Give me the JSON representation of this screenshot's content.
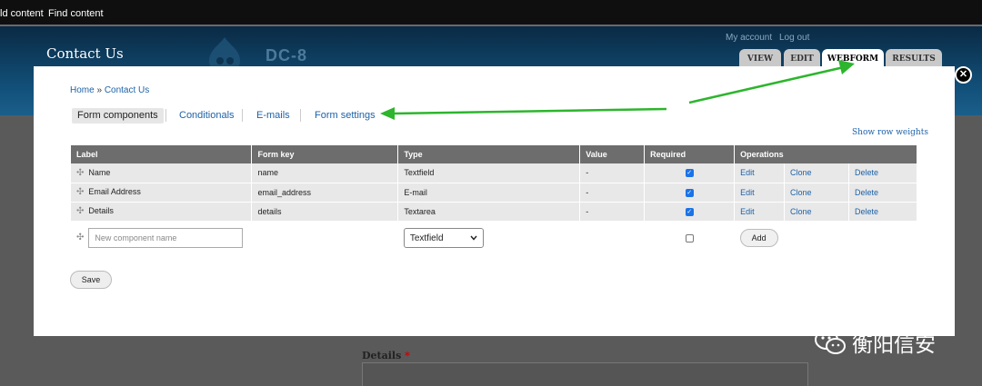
{
  "toolbar": {
    "link1": "ld content",
    "link2": "Find content"
  },
  "header": {
    "slogan": "Contact Us",
    "site_name": "DC-8",
    "secondary_menu": [
      "My account",
      "Log out"
    ],
    "tabs": [
      {
        "label": "VIEW",
        "active": false
      },
      {
        "label": "EDIT",
        "active": false
      },
      {
        "label": "WEBFORM",
        "active": true
      },
      {
        "label": "RESULTS",
        "active": false
      }
    ]
  },
  "overlay": {
    "breadcrumb": {
      "home": "Home",
      "sep": " » ",
      "current": "Contact Us"
    },
    "subtabs": [
      {
        "label": "Form components",
        "active": true
      },
      {
        "label": "Conditionals",
        "active": false
      },
      {
        "label": "E-mails",
        "active": false
      },
      {
        "label": "Form settings",
        "active": false
      }
    ],
    "show_row_weights": "Show row weights",
    "table": {
      "headers": [
        "Label",
        "Form key",
        "Type",
        "Value",
        "Required",
        "Operations"
      ],
      "rows": [
        {
          "label": "Name",
          "key": "name",
          "type": "Textfield",
          "value": "-",
          "required": true,
          "ops": [
            "Edit",
            "Clone",
            "Delete"
          ]
        },
        {
          "label": "Email Address",
          "key": "email_address",
          "type": "E-mail",
          "value": "-",
          "required": true,
          "ops": [
            "Edit",
            "Clone",
            "Delete"
          ]
        },
        {
          "label": "Details",
          "key": "details",
          "type": "Textarea",
          "value": "-",
          "required": true,
          "ops": [
            "Edit",
            "Clone",
            "Delete"
          ]
        }
      ],
      "new_row": {
        "placeholder": "New component name",
        "type_selected": "Textfield",
        "required": false,
        "add_label": "Add"
      }
    },
    "save_label": "Save"
  },
  "page": {
    "details_label": "Details",
    "required_mark": "*"
  },
  "watermark": "衡阳信安",
  "colors": {
    "link": "#1d62a8",
    "arrow": "#2db52d",
    "header_blue": "#12507a"
  }
}
